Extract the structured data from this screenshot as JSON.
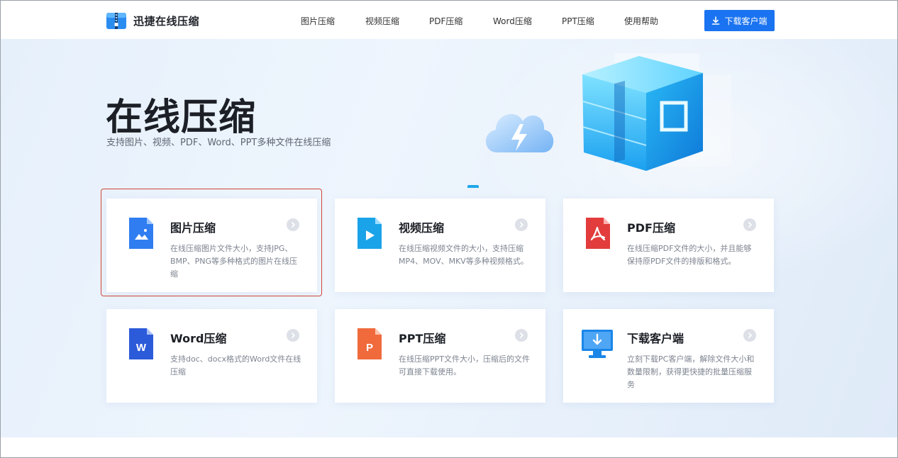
{
  "header": {
    "logo_text": "迅捷在线压缩",
    "nav": [
      "图片压缩",
      "视频压缩",
      "PDF压缩",
      "Word压缩",
      "PPT压缩",
      "使用帮助"
    ],
    "download_button": "下载客户端"
  },
  "hero": {
    "title": "在线压缩",
    "subtitle": "支持图片、视频、PDF、Word、PPT多种文件在线压缩"
  },
  "cards": [
    {
      "title": "图片压缩",
      "desc": "在线压缩图片文件大小，支持JPG、BMP、PNG等多种格式的图片在线压缩",
      "icon": "image-file-icon",
      "color": "#2f7df0"
    },
    {
      "title": "视频压缩",
      "desc": "在线压缩视频文件的大小，支持压缩MP4、MOV、MKV等多种视频格式。",
      "icon": "video-file-icon",
      "color": "#1aa3e8"
    },
    {
      "title": "PDF压缩",
      "desc": "在线压缩PDF文件的大小，并且能够保持原PDF文件的排版和格式。",
      "icon": "pdf-file-icon",
      "color": "#e23c3c"
    },
    {
      "title": "Word压缩",
      "desc": "支持doc、docx格式的Word文件在线压缩",
      "icon": "word-file-icon",
      "color": "#2c5bd9"
    },
    {
      "title": "PPT压缩",
      "desc": "在线压缩PPT文件大小，压缩后的文件可直接下载使用。",
      "icon": "ppt-file-icon",
      "color": "#f06a3c"
    },
    {
      "title": "下载客户端",
      "desc": "立刻下载PC客户端，解除文件大小和数量限制，获得更快捷的批量压缩服务",
      "icon": "desktop-download-icon",
      "color": "#1a86e8"
    }
  ],
  "colors": {
    "accent": "#1a73f0",
    "selection_outline": "#d2453a"
  }
}
